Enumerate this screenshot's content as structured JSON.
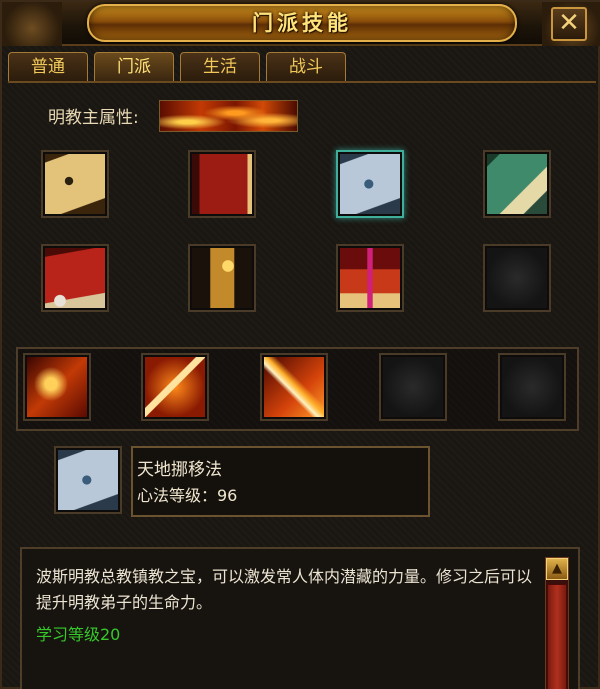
{
  "window": {
    "title": "门派技能",
    "close_label": "✕"
  },
  "tabs": [
    {
      "label": "普通",
      "active": false
    },
    {
      "label": "门派",
      "active": true
    },
    {
      "label": "生活",
      "active": false
    },
    {
      "label": "战斗",
      "active": false
    }
  ],
  "attribute": {
    "label": "明教主属性:",
    "value_icon": "fire-attribute"
  },
  "skill_grid": [
    {
      "icon": "gold-scroll-icon"
    },
    {
      "icon": "red-book-icon"
    },
    {
      "icon": "blue-scroll-icon",
      "selected": true
    },
    {
      "icon": "teal-book-icon"
    },
    {
      "icon": "red-scroll-skull-icon"
    },
    {
      "icon": "gold-tablet-icon"
    },
    {
      "icon": "gift-box-icon"
    },
    {
      "icon": "empty-slot"
    }
  ],
  "skill_bar": [
    {
      "icon": "fire-face-icon"
    },
    {
      "icon": "fire-sword-icon"
    },
    {
      "icon": "fire-slash-icon"
    },
    {
      "icon": "empty-slot"
    },
    {
      "icon": "empty-slot"
    }
  ],
  "selected_skill": {
    "icon": "blue-scroll-icon",
    "name": "天地挪移法",
    "level_text": "心法等级：96"
  },
  "description": {
    "text": "波斯明教总教镇教之宝，可以激发常人体内潜藏的力量。修习之后可以提升明教弟子的生命力。",
    "requirement": "学习等级20",
    "requirement_color": "#35c92a"
  },
  "colors": {
    "title_text": "#ffe27a",
    "tab_text": "#f1c95a",
    "selected_border": "#3fae9a"
  }
}
